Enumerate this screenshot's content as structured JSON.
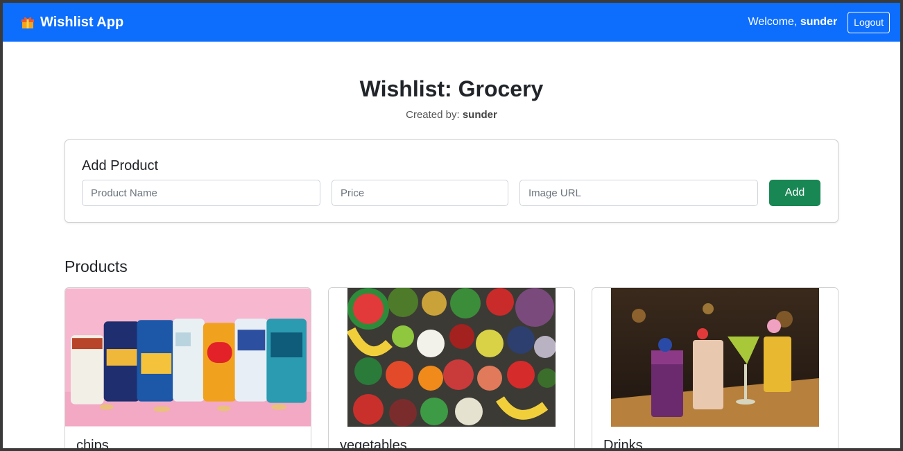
{
  "navbar": {
    "brand": "Wishlist App",
    "welcome_prefix": "Welcome,",
    "username": "sunder",
    "logout_label": "Logout",
    "color": "#0d6efd"
  },
  "wishlist": {
    "title": "Wishlist: Grocery",
    "created_by_label": "Created by:",
    "created_by_user": "sunder"
  },
  "add_product": {
    "heading": "Add Product",
    "name_placeholder": "Product Name",
    "price_placeholder": "Price",
    "url_placeholder": "Image URL",
    "add_label": "Add",
    "add_color": "#198754"
  },
  "products": {
    "heading": "Products",
    "items": [
      {
        "name": "chips",
        "image": "photo of assorted potato chip bags on pink background"
      },
      {
        "name": "vegetables",
        "image": "photo of assorted fruits and vegetables"
      },
      {
        "name": "Drinks",
        "image": "photo of colorful cocktails on bar counter"
      }
    ]
  }
}
